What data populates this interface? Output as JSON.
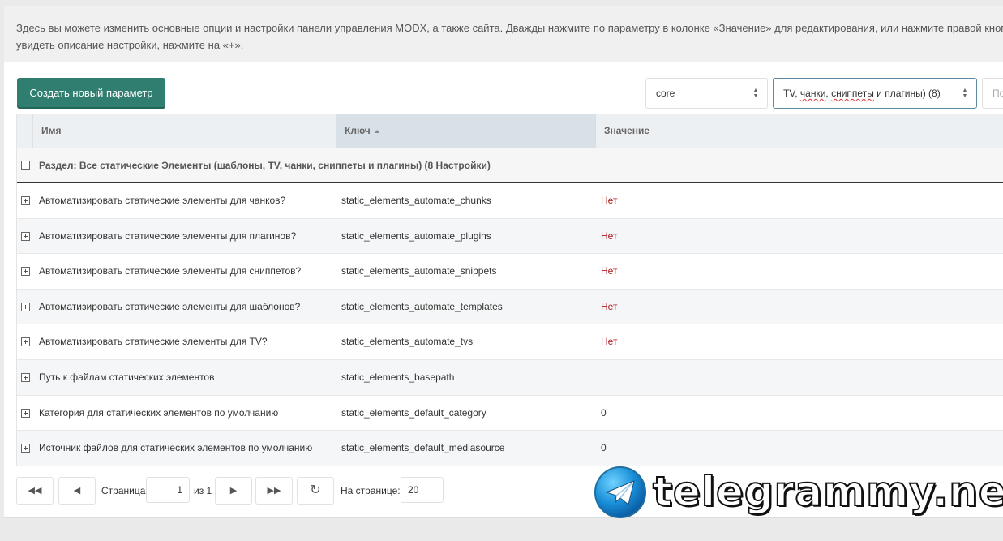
{
  "intro": {
    "line1": "Здесь вы можете изменить основные опции и настройки панели управления MODX, а также сайта. Дважды нажмите по параметру в колонке «Значение» для редактирования, или нажмите правой кноп",
    "line2": "увидеть описание настройки, нажмите на «+»."
  },
  "toolbar": {
    "create_label": "Создать новый параметр",
    "namespace_value": "core",
    "area_value_prefix": "TV, ",
    "area_value_word1": "чанки",
    "area_value_mid": ", ",
    "area_value_word2": "сниппеты",
    "area_value_suffix": " и плагины) (8)",
    "search_placeholder": "По"
  },
  "grid": {
    "columns": {
      "name": "Имя",
      "key": "Ключ",
      "value": "Значение"
    },
    "group_title": "Раздел: Все статические Элементы (шаблоны, TV, чанки, сниппеты и плагины) (8 Настройки)",
    "rows": [
      {
        "name": "Автоматизировать статические элементы для чанков?",
        "key": "static_elements_automate_chunks",
        "value": "Нет"
      },
      {
        "name": "Автоматизировать статические элементы для плагинов?",
        "key": "static_elements_automate_plugins",
        "value": "Нет"
      },
      {
        "name": "Автоматизировать статические элементы для сниппетов?",
        "key": "static_elements_automate_snippets",
        "value": "Нет"
      },
      {
        "name": "Автоматизировать статические элементы для шаблонов?",
        "key": "static_elements_automate_templates",
        "value": "Нет"
      },
      {
        "name": "Автоматизировать статические элементы для TV?",
        "key": "static_elements_automate_tvs",
        "value": "Нет"
      },
      {
        "name": "Путь к файлам статических элементов",
        "key": "static_elements_basepath",
        "value": ""
      },
      {
        "name": "Категория для статических элементов по умолчанию",
        "key": "static_elements_default_category",
        "value": "0"
      },
      {
        "name": "Источник файлов для статических элементов по умолчанию",
        "key": "static_elements_default_mediasource",
        "value": "0"
      }
    ]
  },
  "pager": {
    "page_label": "Страница",
    "page_value": "1",
    "of_label": "из 1",
    "per_page_label": "На странице:",
    "per_page_value": "20"
  },
  "watermark": {
    "text": "telegrammy.net"
  },
  "colors": {
    "accent": "#2f7e70",
    "no_value": "#b0191e"
  }
}
